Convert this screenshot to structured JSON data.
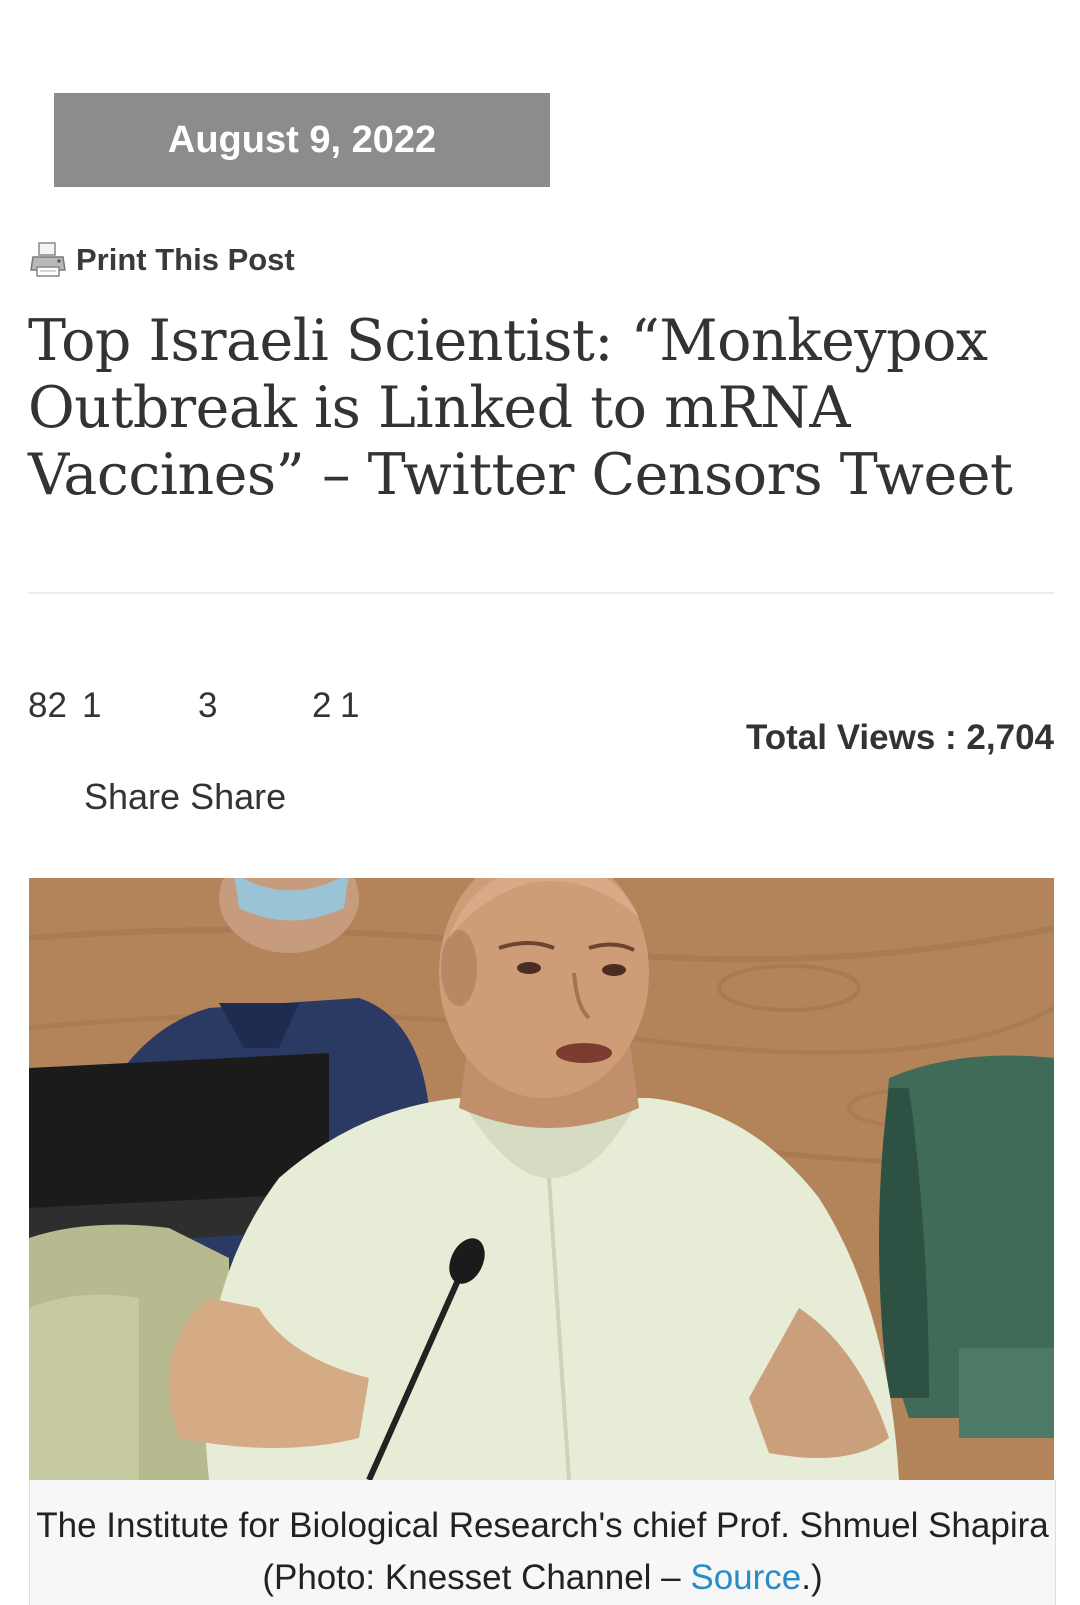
{
  "post": {
    "date": "August 9, 2022",
    "print_label": "Print This Post",
    "title": "Top Israeli Scientist: “Monkeypox Outbreak is Linked to mRNA Vaccines” – Twitter Censors Tweet"
  },
  "share_bar": {
    "counts": [
      "82",
      "1",
      "3",
      "2",
      "1"
    ],
    "share_labels": [
      "Share",
      "Share"
    ],
    "total_views_label": "Total Views : 2,704"
  },
  "figure": {
    "caption_text": "The Institute for Biological Research's chief Prof. Shmuel Shapira (Photo: Knesset Channel – ",
    "caption_link": "Source",
    "caption_end": ".)"
  },
  "icons": {
    "print": "printer-icon"
  },
  "colors": {
    "date_background": "#8c8c8c",
    "link": "#2a8cc6"
  }
}
